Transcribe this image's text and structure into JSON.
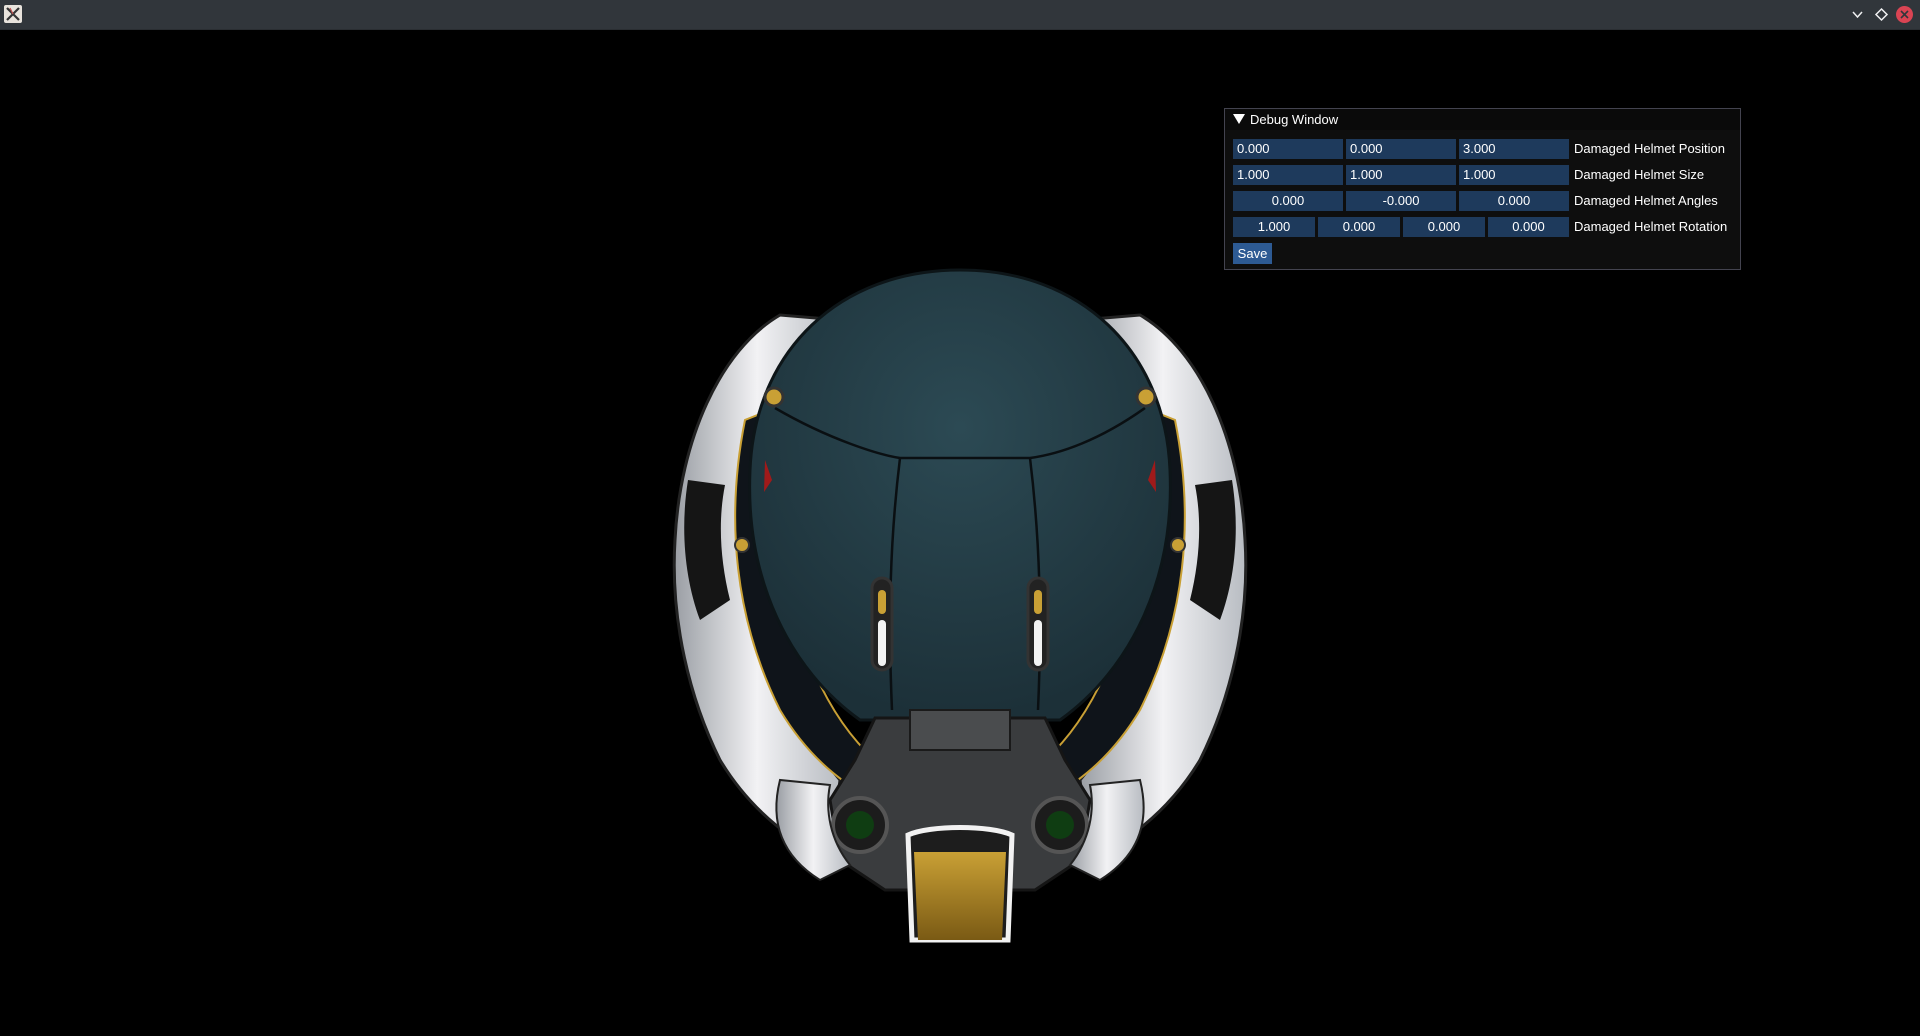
{
  "window": {
    "app_icon": "x-app-icon",
    "buttons": [
      "minimize-icon",
      "maximize-icon",
      "close-icon"
    ],
    "close_color": "#da4453"
  },
  "debug_window": {
    "title": "Debug Window",
    "rows": [
      {
        "label": "Damaged Helmet Position",
        "values": [
          "0.000",
          "0.000",
          "3.000"
        ]
      },
      {
        "label": "Damaged Helmet Size",
        "values": [
          "1.000",
          "1.000",
          "1.000"
        ]
      },
      {
        "label": "Damaged Helmet Angles",
        "values": [
          "0.000",
          "-0.000",
          "0.000"
        ]
      },
      {
        "label": "Damaged Helmet Rotation",
        "values": [
          "1.000",
          "0.000",
          "0.000",
          "0.000"
        ]
      }
    ],
    "save_label": "Save",
    "field_color": "#1e3a5c",
    "button_color": "#2d5a93"
  },
  "scene": {
    "object": "damaged-helmet-model",
    "background_color": "#000000"
  }
}
